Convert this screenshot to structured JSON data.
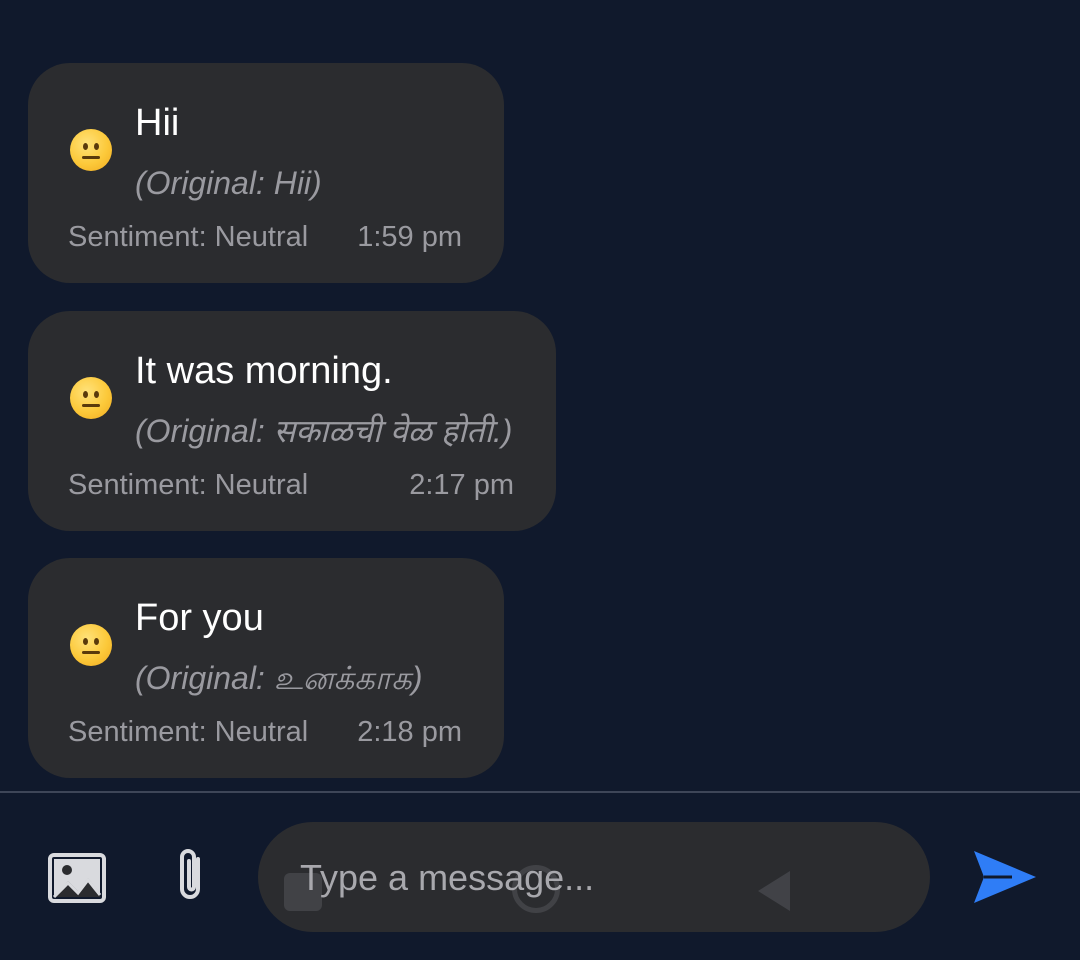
{
  "messages": [
    {
      "emoji": "neutral-face-icon",
      "text": "Hii",
      "original": "(Original: Hii)",
      "sentiment": "Sentiment: Neutral",
      "time": "1:59 pm"
    },
    {
      "emoji": "neutral-face-icon",
      "text": "It was morning.",
      "original": "(Original: सकाळची वेळ होती.)",
      "sentiment": "Sentiment: Neutral",
      "time": "2:17 pm"
    },
    {
      "emoji": "neutral-face-icon",
      "text": "For you",
      "original": "(Original: உனக்காக)",
      "sentiment": "Sentiment: Neutral",
      "time": "2:18 pm"
    }
  ],
  "composer": {
    "placeholder": "Type a message...",
    "icons": {
      "gallery": "image-gallery-icon",
      "attach": "paperclip-icon",
      "send": "send-icon"
    }
  },
  "colors": {
    "background": "#10192c",
    "bubble": "#2b2c2f",
    "secondary_text": "#9a9aa0",
    "send_accent": "#2f7df6"
  }
}
